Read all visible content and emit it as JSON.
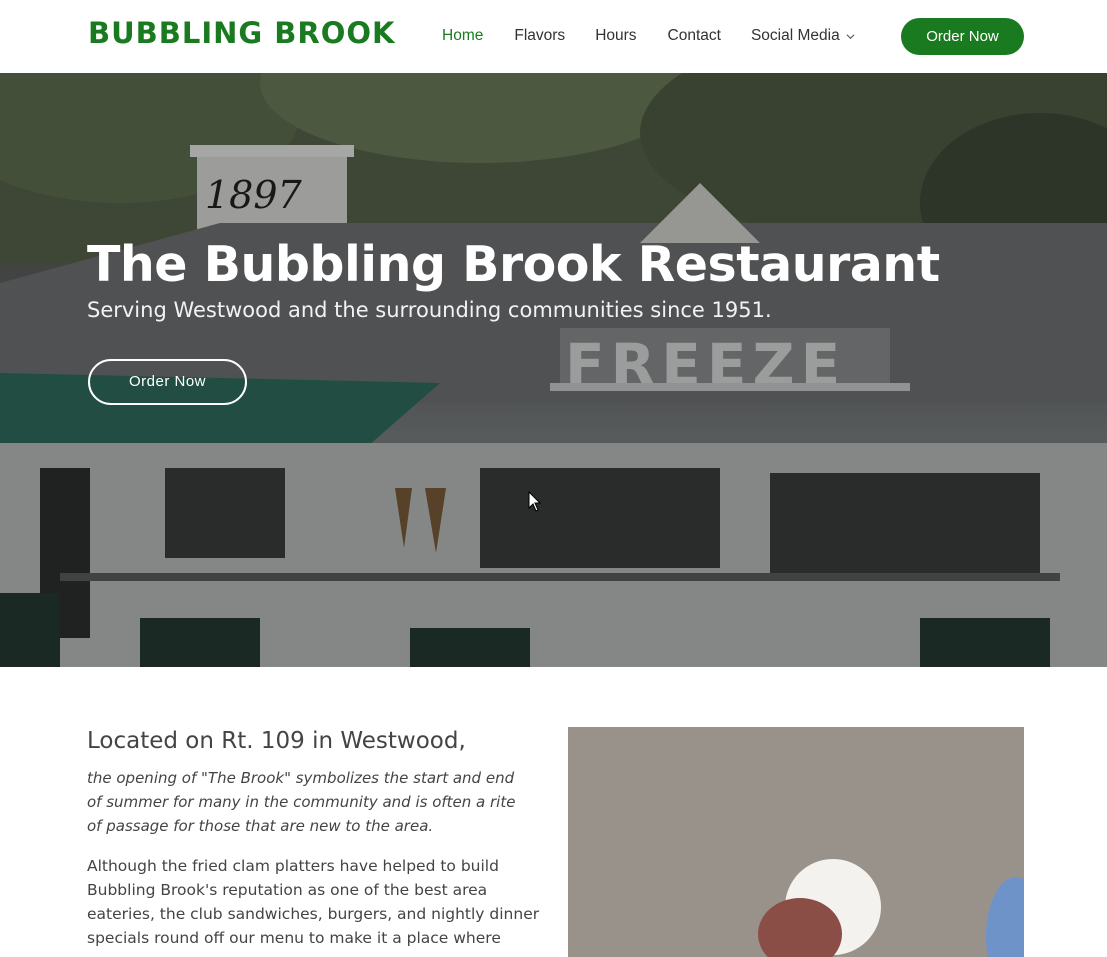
{
  "header": {
    "logo": "BUBBLING BROOK",
    "nav": [
      {
        "label": "Home"
      },
      {
        "label": "Flavors"
      },
      {
        "label": "Hours"
      },
      {
        "label": "Contact"
      },
      {
        "label": "Social Media"
      }
    ],
    "order_button": "Order Now"
  },
  "hero": {
    "title": "The Bubbling Brook Restaurant",
    "subtitle": "Serving Westwood and the surrounding communities since 1951.",
    "button": "Order Now",
    "photo_text": {
      "chimney_year": "1897",
      "sign": "FREEZE"
    }
  },
  "about": {
    "heading": "Located on Rt. 109 in Westwood,",
    "lead": "the opening of \"The Brook\" symbolizes the start and end of summer for many in the community and is often a rite of passage for those that are new to the area.",
    "body": "Although the fried clam platters have helped to build Bubbling Brook's reputation as one of the best area eateries, the club sandwiches, burgers, and nightly dinner specials round off our menu to make it a place where everyone can"
  },
  "colors": {
    "brand_green": "#1a7a1f",
    "text": "#444444",
    "white": "#ffffff"
  }
}
